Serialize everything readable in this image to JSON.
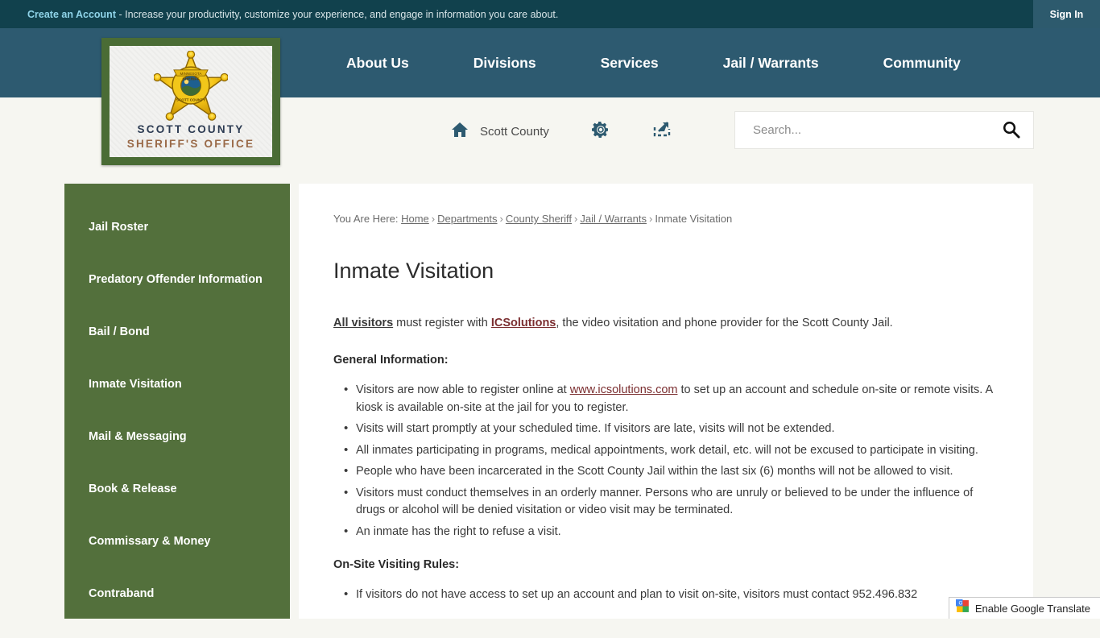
{
  "topbar": {
    "create_account_link": "Create an Account",
    "message": " - Increase your productivity, customize your experience, and engage in information you care about.",
    "signin_label": "Sign In"
  },
  "nav": {
    "items": [
      {
        "label": "About Us"
      },
      {
        "label": "Divisions"
      },
      {
        "label": "Services"
      },
      {
        "label": "Jail / Warrants"
      },
      {
        "label": "Community"
      }
    ]
  },
  "logo": {
    "title": "SCOTT COUNTY",
    "subtitle": "SHERIFF'S OFFICE",
    "badge_center_top": "SHERIFF",
    "badge_center_bottom": "SCOTT COUNTY"
  },
  "subrow": {
    "home_label": "Scott County",
    "home_icon": "home-icon",
    "gear_icon": "gear-icon",
    "share_icon": "share-icon"
  },
  "search": {
    "placeholder": "Search...",
    "value": "",
    "icon": "search-icon"
  },
  "sidebar": {
    "items": [
      {
        "label": "Jail Roster"
      },
      {
        "label": "Predatory Offender Information"
      },
      {
        "label": "Bail / Bond"
      },
      {
        "label": "Inmate Visitation"
      },
      {
        "label": "Mail & Messaging"
      },
      {
        "label": "Book & Release"
      },
      {
        "label": "Commissary & Money"
      },
      {
        "label": "Contraband"
      }
    ]
  },
  "breadcrumb": {
    "prefix": "You Are Here:",
    "links": [
      "Home",
      "Departments",
      "County Sheriff",
      "Jail / Warrants"
    ],
    "current": "Inmate Visitation",
    "separator": "›"
  },
  "main": {
    "title": "Inmate Visitation",
    "intro": {
      "part1": "All visitors",
      "part2": " must register with ",
      "part3": "ICSolutions",
      "part4": ", the video visitation and phone provider for the Scott County Jail."
    },
    "general_heading": "General Information:",
    "general_bullets": [
      {
        "pre": "Visitors are now able to register online at ",
        "link": "www.icsolutions.com",
        "post": " to set up an account and schedule on-site or remote visits.  A kiosk is available on-site at the jail for you to register."
      },
      {
        "pre": "Visits will start promptly at your scheduled time.  If visitors are late, visits will not be extended.",
        "link": "",
        "post": ""
      },
      {
        "pre": "All inmates participating in programs, medical appointments, work detail, etc. will not be excused to participate in visiting.",
        "link": "",
        "post": ""
      },
      {
        "pre": "People who have been incarcerated in the Scott County Jail within the last six (6) months will not be allowed to visit.",
        "link": "",
        "post": ""
      },
      {
        "pre": "Visitors must conduct themselves in an orderly manner. Persons who are unruly or believed to be under the influence of drugs or alcohol will be denied visitation or video visit may be terminated.",
        "link": "",
        "post": ""
      },
      {
        "pre": "An inmate has the right to refuse a visit.",
        "link": "",
        "post": ""
      }
    ],
    "onsite_heading": "On-Site Visiting Rules:",
    "onsite_bullets": [
      {
        "pre": "If visitors do not have access to set up an account and plan to visit on-site, visitors must contact 952.496.832",
        "link": "",
        "post": ""
      }
    ]
  },
  "translate": {
    "label": "Enable Google Translate",
    "icon": "google-translate-icon"
  },
  "colors": {
    "topbar_bg": "#11414d",
    "nav_bg": "#2d5a70",
    "sidebar_bg": "#53703c",
    "page_bg": "#f6f6f1",
    "content_bg": "#ffffff",
    "link_red": "#7b2e30",
    "accent_light_blue": "#8fd3e8",
    "logo_frame": "#4a6c35"
  }
}
